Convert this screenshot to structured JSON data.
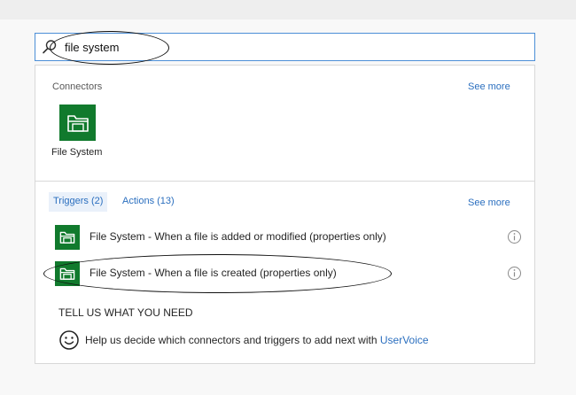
{
  "search": {
    "value": "file system",
    "icon": "search-icon"
  },
  "connectors": {
    "section_label": "Connectors",
    "see_more": "See more",
    "items": [
      {
        "name": "File System",
        "icon": "folder-icon",
        "color": "#117a2d"
      }
    ]
  },
  "tabs": {
    "triggers": "Triggers (2)",
    "actions": "Actions (13)",
    "see_more": "See more"
  },
  "triggers": [
    {
      "label": "File System - When a file is added or modified (properties only)",
      "icon": "folder-icon"
    },
    {
      "label": "File System - When a file is created (properties only)",
      "icon": "folder-icon"
    }
  ],
  "feedback": {
    "heading": "TELL US WHAT YOU NEED",
    "text": "Help us decide which connectors and triggers to add next with ",
    "link": "UserVoice"
  },
  "colors": {
    "accent": "#2b6fbf",
    "connector_green": "#117a2d",
    "focus_border": "#4c8fd7"
  }
}
